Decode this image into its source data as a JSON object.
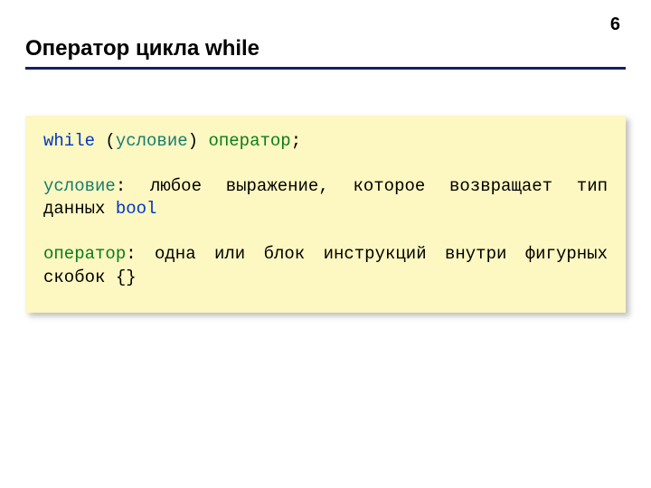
{
  "page_number": "6",
  "title": "Оператор цикла while",
  "line1": {
    "kw_while": "while",
    "open": " (",
    "cond": "условие",
    "close": ") ",
    "op": "оператор",
    "semi": ";"
  },
  "line2": {
    "cond_label": "условие",
    "colon_text": ": любое выражение, которое возвращает тип данных ",
    "bool_kw": "bool"
  },
  "line3": {
    "op_label": "оператор",
    "colon_text": ": одна или блок инструкций внутри фигурных скобок {}"
  }
}
